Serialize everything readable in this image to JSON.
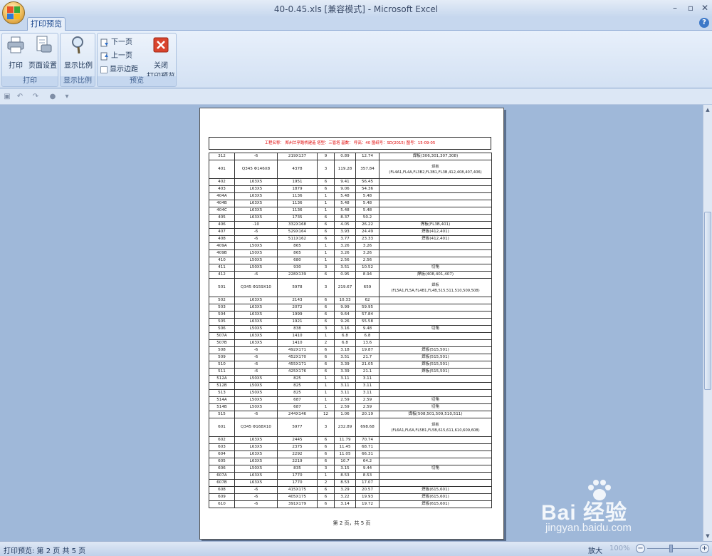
{
  "window": {
    "title": "40-0.45.xls  [兼容模式] - Microsoft Excel",
    "minimize": "–",
    "restore": "▫",
    "close": "✕"
  },
  "ribbon": {
    "tab_label": "打印预览",
    "help": "?",
    "groups": {
      "print": {
        "label": "打印",
        "print_button": "打印",
        "page_setup_button": "页面设置"
      },
      "zoom": {
        "label": "显示比例",
        "zoom_button": "显示比例"
      },
      "preview": {
        "label": "预览",
        "next_page": "下一页",
        "prev_page": "上一页",
        "show_margins": "显示边距",
        "close_line1": "关闭",
        "close_line2": "打印预览"
      }
    }
  },
  "page": {
    "header": "工程名称：  郑州兰亭路桥建造  塔型：三管塔      基数：    呼高：40    图纸号：SD(2015)    图号：15-09-05",
    "footer": "第 2 页，共 5 页",
    "rows": [
      [
        "312",
        "-6",
        "219X137",
        "9",
        "0.89",
        "12.74",
        "焊板(306,301,307,308)"
      ],
      [
        "401",
        "Q345  Φ146X8",
        "4378",
        "3",
        "119.28",
        "357.84",
        "焊板\n(FL4A1,FL4A,FL3B2,FL3B1,FL3B,412,408,407,406)"
      ],
      [
        "402",
        "L63X5",
        "1951",
        "6",
        "9.41",
        "56.45",
        ""
      ],
      [
        "403",
        "L63X5",
        "1879",
        "6",
        "9.06",
        "54.36",
        ""
      ],
      [
        "404A",
        "L63X5",
        "1136",
        "1",
        "5.48",
        "5.48",
        ""
      ],
      [
        "404B",
        "L63X5",
        "1136",
        "1",
        "5.48",
        "5.48",
        ""
      ],
      [
        "404C",
        "L63X5",
        "1136",
        "1",
        "5.48",
        "5.48",
        ""
      ],
      [
        "405",
        "L63X5",
        "1735",
        "6",
        "8.37",
        "50.2",
        ""
      ],
      [
        "406",
        "-10",
        "332X168",
        "6",
        "4.05",
        "26.22",
        "焊板(FL3B,401)"
      ],
      [
        "407",
        "-6",
        "529X164",
        "6",
        "3.93",
        "24.49",
        "焊板(412,401)"
      ],
      [
        "408",
        "-6",
        "511X162",
        "6",
        "3.77",
        "23.33",
        "焊板(412,401)"
      ],
      [
        "409A",
        "L50X5",
        "865",
        "1",
        "3.26",
        "3.26",
        ""
      ],
      [
        "409B",
        "L50X5",
        "865",
        "1",
        "3.26",
        "3.26",
        ""
      ],
      [
        "410",
        "L50X5",
        "680",
        "1",
        "2.56",
        "2.56",
        ""
      ],
      [
        "411",
        "L50X5",
        "930",
        "3",
        "3.51",
        "10.52",
        "切角"
      ],
      [
        "412",
        "-6",
        "228X139",
        "6",
        "0.95",
        "8.94",
        "焊板(408,401,407)"
      ],
      [
        "501",
        "Q345  Φ159X10",
        "5978",
        "3",
        "219.67",
        "659",
        "焊板\n(FL5A1,FL5A,FL4B1,FL4B,515,511,510,509,508)"
      ],
      [
        "502",
        "L63X5",
        "2143",
        "6",
        "10.33",
        "62",
        ""
      ],
      [
        "503",
        "L63X5",
        "2072",
        "6",
        "9.99",
        "59.95",
        ""
      ],
      [
        "504",
        "L63X5",
        "1999",
        "6",
        "9.64",
        "57.84",
        ""
      ],
      [
        "505",
        "L63X5",
        "1921",
        "6",
        "9.26",
        "55.58",
        ""
      ],
      [
        "506",
        "L50X5",
        "838",
        "3",
        "3.16",
        "9.48",
        "切角"
      ],
      [
        "507A",
        "L63X5",
        "1410",
        "1",
        "6.8",
        "6.8",
        ""
      ],
      [
        "507B",
        "L63X5",
        "1410",
        "2",
        "6.8",
        "13.6",
        ""
      ],
      [
        "508",
        "-6",
        "492X171",
        "6",
        "3.18",
        "19.87",
        "焊板(515,501)"
      ],
      [
        "509",
        "-6",
        "452X170",
        "6",
        "3.51",
        "21.7",
        "焊板(515,501)"
      ],
      [
        "510",
        "-6",
        "455X171",
        "6",
        "3.39",
        "21.05",
        "焊板(515,501)"
      ],
      [
        "511",
        "-6",
        "425X176",
        "6",
        "3.39",
        "21.1",
        "焊板(515,501)"
      ],
      [
        "512A",
        "L50X5",
        "825",
        "1",
        "3.11",
        "3.11",
        ""
      ],
      [
        "512B",
        "L50X5",
        "825",
        "1",
        "3.11",
        "3.11",
        ""
      ],
      [
        "513",
        "L50X5",
        "825",
        "1",
        "3.11",
        "3.11",
        ""
      ],
      [
        "514A",
        "L50X5",
        "687",
        "1",
        "2.59",
        "2.59",
        "切角"
      ],
      [
        "514B",
        "L50X5",
        "687",
        "1",
        "2.59",
        "2.59",
        "切角"
      ],
      [
        "515",
        "-6",
        "244X146",
        "12",
        "1.06",
        "20.19",
        "焊板(508,501,509,510,511)"
      ],
      [
        "601",
        "Q345  Φ168X10",
        "5977",
        "3",
        "232.89",
        "698.68",
        "焊板\n(FL6A1,FL6A,FL5B1,FL5B,615,611,610,609,608)"
      ],
      [
        "602",
        "L63X5",
        "2445",
        "6",
        "11.79",
        "70.74",
        ""
      ],
      [
        "603",
        "L63X5",
        "2375",
        "6",
        "11.45",
        "68.71",
        ""
      ],
      [
        "604",
        "L63X5",
        "2292",
        "6",
        "11.05",
        "66.31",
        ""
      ],
      [
        "605",
        "L63X5",
        "2219",
        "6",
        "10.7",
        "64.2",
        ""
      ],
      [
        "606",
        "L50X5",
        "835",
        "3",
        "3.15",
        "9.44",
        "切角"
      ],
      [
        "607A",
        "L63X5",
        "1770",
        "1",
        "8.53",
        "8.53",
        ""
      ],
      [
        "607B",
        "L63X5",
        "1770",
        "2",
        "8.53",
        "17.07",
        ""
      ],
      [
        "608",
        "-6",
        "415X175",
        "6",
        "3.29",
        "20.57",
        "焊板(615,601)"
      ],
      [
        "609",
        "-6",
        "405X175",
        "6",
        "3.22",
        "19.93",
        "焊板(615,601)"
      ],
      [
        "610",
        "-6",
        "391X179",
        "6",
        "3.14",
        "19.72",
        "焊板(615,601)"
      ]
    ]
  },
  "statusbar": {
    "text": "打印预览: 第 2 页 共 5 页",
    "zoom_in_label": "放大",
    "zoom_percent": "100%",
    "zoom_minus": "−",
    "zoom_plus": "+"
  },
  "watermark": {
    "brand": "Bai  经验",
    "url": "jingyan.baidu.com"
  },
  "colors": {
    "header_text": "#e00000",
    "workspace": "#9fb8d9",
    "ribbon": "#dbe7f6"
  }
}
